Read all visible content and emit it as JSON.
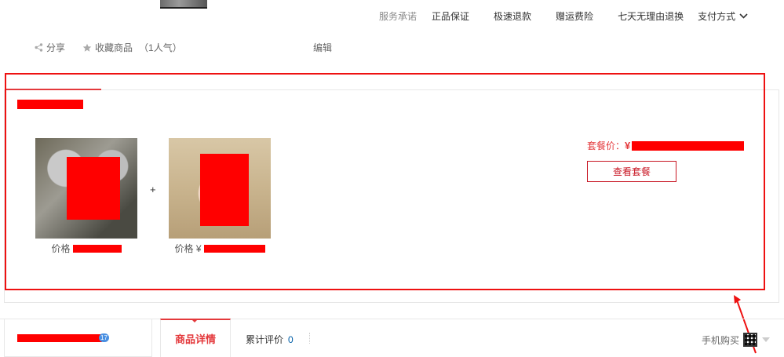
{
  "service": {
    "title": "服务承诺",
    "items": [
      "正品保证",
      "极速退款",
      "赠运费险",
      "七天无理由退换"
    ],
    "payment": "支付方式"
  },
  "actions": {
    "share": "分享",
    "favorite": "收藏商品",
    "popularity": "（1人气）",
    "edit": "编辑"
  },
  "package": {
    "products": [
      {
        "image": "koala-photo",
        "price_label": "价格"
      },
      {
        "image": "baby-hood-photo",
        "price_label": "价格 ¥"
      }
    ],
    "plus": "+",
    "price_label": "套餐价：",
    "currency": "¥",
    "view_button": "查看套餐"
  },
  "bottom": {
    "shop_badge": "17",
    "tabs": {
      "detail": "商品详情",
      "reviews": "累计评价",
      "reviews_count": "0"
    },
    "mobile_buy": "手机购买"
  },
  "colors": {
    "accent": "#e4393c",
    "annotation": "#ee1111",
    "redaction": "#ff0000"
  }
}
